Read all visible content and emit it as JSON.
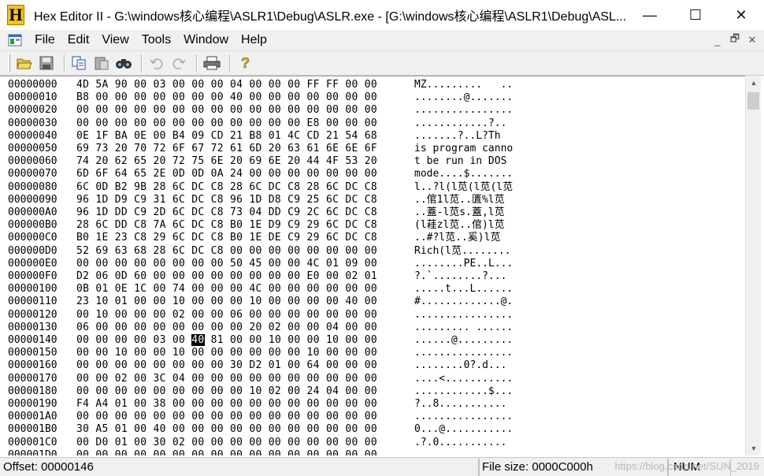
{
  "window": {
    "title": "Hex Editor II - G:\\windows核心编程\\ASLR1\\Debug\\ASLR.exe - [G:\\windows核心编程\\ASLR1\\Debug\\ASL...",
    "app_icon_letter": "H",
    "minimize": "—",
    "maximize": "☐",
    "close": "✕"
  },
  "menu": {
    "items": [
      "File",
      "Edit",
      "View",
      "Tools",
      "Window",
      "Help"
    ],
    "mdi_minimize": "_",
    "mdi_restore": "🗗",
    "mdi_close": "✕"
  },
  "toolbar": {
    "buttons": [
      "open-icon",
      "save-icon",
      "copy-icon",
      "paste-icon",
      "find-icon",
      "undo-icon",
      "redo-icon",
      "print-icon",
      "help-icon"
    ]
  },
  "hex": {
    "rows": [
      {
        "offset": "00000000",
        "bytes": "4D 5A 90 00 03 00 00 00 04 00 00 00 FF FF 00 00",
        "ascii": "MZ.........   .."
      },
      {
        "offset": "00000010",
        "bytes": "B8 00 00 00 00 00 00 00 40 00 00 00 00 00 00 00",
        "ascii": "........@......."
      },
      {
        "offset": "00000020",
        "bytes": "00 00 00 00 00 00 00 00 00 00 00 00 00 00 00 00",
        "ascii": "................"
      },
      {
        "offset": "00000030",
        "bytes": "00 00 00 00 00 00 00 00 00 00 00 00 E8 00 00 00",
        "ascii": "............?.."
      },
      {
        "offset": "00000040",
        "bytes": "0E 1F BA 0E 00 B4 09 CD 21 B8 01 4C CD 21 54 68",
        "ascii": ".......?..L?Th"
      },
      {
        "offset": "00000050",
        "bytes": "69 73 20 70 72 6F 67 72 61 6D 20 63 61 6E 6E 6F",
        "ascii": "is program canno"
      },
      {
        "offset": "00000060",
        "bytes": "74 20 62 65 20 72 75 6E 20 69 6E 20 44 4F 53 20",
        "ascii": "t be run in DOS "
      },
      {
        "offset": "00000070",
        "bytes": "6D 6F 64 65 2E 0D 0D 0A 24 00 00 00 00 00 00 00",
        "ascii": "mode....$......."
      },
      {
        "offset": "00000080",
        "bytes": "6C 0D B2 9B 28 6C DC C8 28 6C DC C8 28 6C DC C8",
        "ascii": "l..?l(l苋(l苋(l苋"
      },
      {
        "offset": "00000090",
        "bytes": "96 1D D9 C9 31 6C DC C8 96 1D D8 C9 25 6C DC C8",
        "ascii": "..倌1l苋..匱%l苋"
      },
      {
        "offset": "000000A0",
        "bytes": "96 1D DD C9 2D 6C DC C8 73 04 DD C9 2C 6C DC C8",
        "ascii": "..蓋-l苋s.蓋,l苋"
      },
      {
        "offset": "000000B0",
        "bytes": "28 6C DD C8 7A 6C DC C8 B0 1E D9 C9 29 6C DC C8",
        "ascii": "(l蓕zl苋..倌)l苋"
      },
      {
        "offset": "000000C0",
        "bytes": "B0 1E 23 C8 29 6C DC C8 B0 1E DE C9 29 6C DC C8",
        "ascii": "..#?l苋..奚)l苋"
      },
      {
        "offset": "000000D0",
        "bytes": "52 69 63 68 28 6C DC C8 00 00 00 00 00 00 00 00",
        "ascii": "Rich(l苋........"
      },
      {
        "offset": "000000E0",
        "bytes": "00 00 00 00 00 00 00 00 50 45 00 00 4C 01 09 00",
        "ascii": "........PE..L..."
      },
      {
        "offset": "000000F0",
        "bytes": "D2 06 0D 60 00 00 00 00 00 00 00 00 E0 00 02 01",
        "ascii": "?.`........?..."
      },
      {
        "offset": "00000100",
        "bytes": "0B 01 0E 1C 00 74 00 00 00 4C 00 00 00 00 00 00",
        "ascii": ".....t...L......"
      },
      {
        "offset": "00000110",
        "bytes": "23 10 01 00 00 10 00 00 00 10 00 00 00 00 40 00",
        "ascii": "#.............@."
      },
      {
        "offset": "00000120",
        "bytes": "00 10 00 00 00 02 00 00 06 00 00 00 00 00 00 00",
        "ascii": "................"
      },
      {
        "offset": "00000130",
        "bytes": "06 00 00 00 00 00 00 00 00 20 02 00 00 04 00 00",
        "ascii": "......... ......"
      },
      {
        "offset": "00000140",
        "bytes_before": "00 00 00 00 03 00 ",
        "bytes_caret": "40",
        "bytes_after": " 81 00 00 10 00 00 10 00 00",
        "ascii": "......@........."
      },
      {
        "offset": "00000150",
        "bytes": "00 00 10 00 00 10 00 00 00 00 00 00 10 00 00 00",
        "ascii": "................"
      },
      {
        "offset": "00000160",
        "bytes": "00 00 00 00 00 00 00 00 30 D2 01 00 64 00 00 00",
        "ascii": "........0?.d..."
      },
      {
        "offset": "00000170",
        "bytes": "00 00 02 00 3C 04 00 00 00 00 00 00 00 00 00 00",
        "ascii": "....<..........."
      },
      {
        "offset": "00000180",
        "bytes": "00 00 00 00 00 00 00 00 00 10 02 00 24 04 00 00",
        "ascii": "............$..."
      },
      {
        "offset": "00000190",
        "bytes": "F4 A4 01 00 38 00 00 00 00 00 00 00 00 00 00 00",
        "ascii": "?..8..........."
      },
      {
        "offset": "000001A0",
        "bytes": "00 00 00 00 00 00 00 00 00 00 00 00 00 00 00 00",
        "ascii": "................"
      },
      {
        "offset": "000001B0",
        "bytes": "30 A5 01 00 40 00 00 00 00 00 00 00 00 00 00 00",
        "ascii": "0...@..........."
      },
      {
        "offset": "000001C0",
        "bytes": "00 D0 01 00 30 02 00 00 00 00 00 00 00 00 00 00",
        "ascii": ".?.0..........."
      },
      {
        "offset": "000001D0",
        "bytes": "00 00 00 00 00 00 00 00 00 00 00 00 00 00 00 00",
        "ascii": "................"
      }
    ]
  },
  "status": {
    "offset": "Offset: 00000146",
    "file_size": "File size: 0000C000h",
    "num": "NUM",
    "watermark": "https://blog.csdn.net/SUN_2019"
  }
}
